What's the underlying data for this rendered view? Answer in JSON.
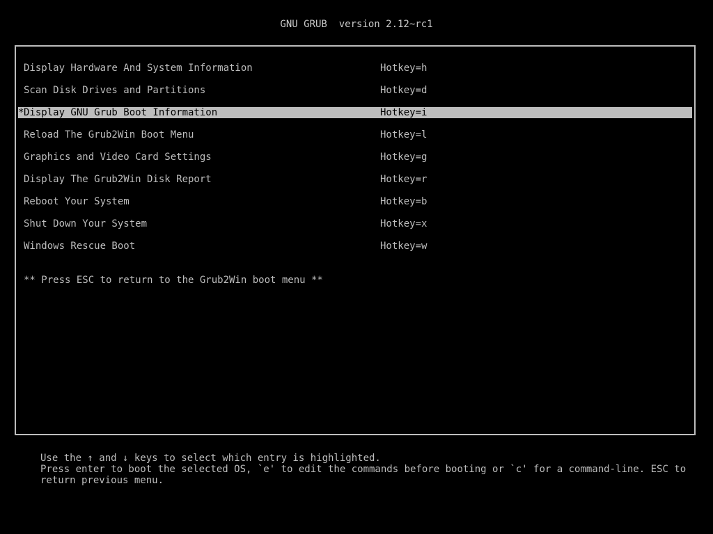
{
  "header": {
    "title": "GNU GRUB  version 2.12~rc1"
  },
  "menu": {
    "items": [
      {
        "marker": "",
        "label": "Display Hardware And System Information",
        "hotkey": "Hotkey=h",
        "selected": false
      },
      {
        "marker": "",
        "label": "Scan Disk Drives and Partitions",
        "hotkey": "Hotkey=d",
        "selected": false
      },
      {
        "marker": "*",
        "label": "Display GNU Grub Boot Information",
        "hotkey": "Hotkey=i",
        "selected": true
      },
      {
        "marker": "",
        "label": "Reload The Grub2Win Boot Menu",
        "hotkey": "Hotkey=l",
        "selected": false
      },
      {
        "marker": "",
        "label": "Graphics and Video Card Settings",
        "hotkey": "Hotkey=g",
        "selected": false
      },
      {
        "marker": "",
        "label": "Display The Grub2Win Disk Report",
        "hotkey": "Hotkey=r",
        "selected": false
      },
      {
        "marker": "",
        "label": "Reboot Your System",
        "hotkey": "Hotkey=b",
        "selected": false
      },
      {
        "marker": "",
        "label": "Shut Down Your System",
        "hotkey": "Hotkey=x",
        "selected": false
      },
      {
        "marker": "",
        "label": "Windows Rescue Boot",
        "hotkey": "Hotkey=w",
        "selected": false
      }
    ],
    "note": "** Press ESC to return to the Grub2Win boot menu **"
  },
  "help": {
    "line1": "Use the ↑ and ↓ keys to select which entry is highlighted.",
    "line2": "Press enter to boot the selected OS, `e' to edit the commands before booting or `c' for a command-line. ESC to",
    "line3": "return previous menu."
  },
  "colors": {
    "background": "#000000",
    "text": "#bdbdbd",
    "highlight_bg": "#bdbdbd",
    "highlight_fg": "#000000"
  }
}
